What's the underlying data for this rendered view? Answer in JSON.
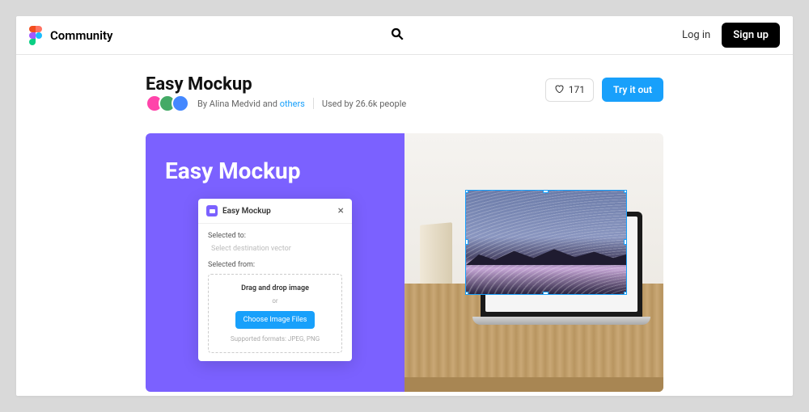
{
  "header": {
    "community_label": "Community",
    "login_label": "Log in",
    "signup_label": "Sign up"
  },
  "resource": {
    "title": "Easy Mockup",
    "by_prefix": "By ",
    "author": "Alina Medvid",
    "and_word": " and ",
    "others_label": "others",
    "usage": "Used by 26.6k people"
  },
  "actions": {
    "like_count": "171",
    "try_label": "Try it out"
  },
  "hero": {
    "title": "Easy Mockup"
  },
  "plugin_panel": {
    "title": "Easy Mockup",
    "selected_to_label": "Selected to:",
    "selected_to_placeholder": "Select destination vector",
    "selected_from_label": "Selected from:",
    "drop_title": "Drag and drop image",
    "or_label": "or",
    "choose_btn_label": "Choose Image Files",
    "formats_label": "Supported formats: JPEG, PNG"
  }
}
